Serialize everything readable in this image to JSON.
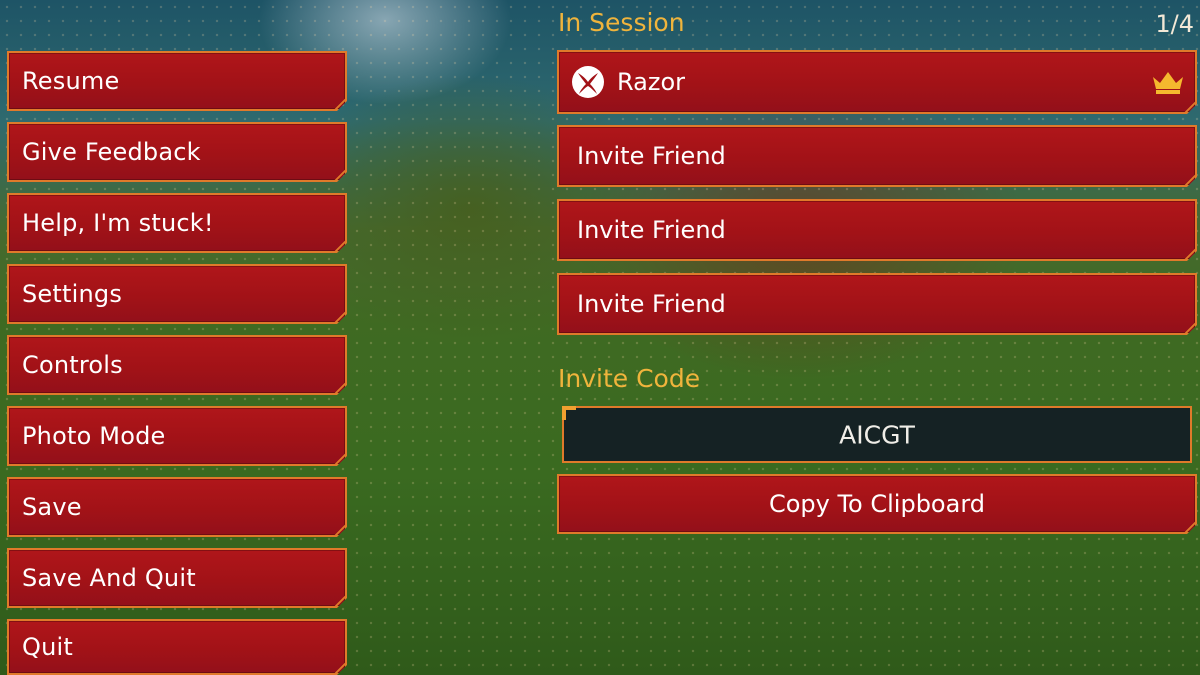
{
  "menu": {
    "items": [
      {
        "label": "Resume"
      },
      {
        "label": "Give Feedback"
      },
      {
        "label": "Help, I'm stuck!"
      },
      {
        "label": "Settings"
      },
      {
        "label": "Controls"
      },
      {
        "label": "Photo Mode"
      },
      {
        "label": "Save"
      },
      {
        "label": "Save And Quit"
      },
      {
        "label": "Quit"
      }
    ]
  },
  "session": {
    "title": "In Session",
    "player_count": "1/4",
    "host": {
      "name": "Razor",
      "platform_icon": "xbox-logo-icon",
      "role_icon": "crown-icon"
    },
    "slots": [
      {
        "label": "Invite Friend"
      },
      {
        "label": "Invite Friend"
      },
      {
        "label": "Invite Friend"
      }
    ]
  },
  "invite": {
    "title": "Invite Code",
    "code": "AICGT",
    "copy_label": "Copy To Clipboard"
  },
  "colors": {
    "button_fill": "#a21217",
    "button_border": "#e07a2a",
    "accent_text": "#f0b43c",
    "crown": "#f5b82e",
    "code_bg": "#152224"
  }
}
